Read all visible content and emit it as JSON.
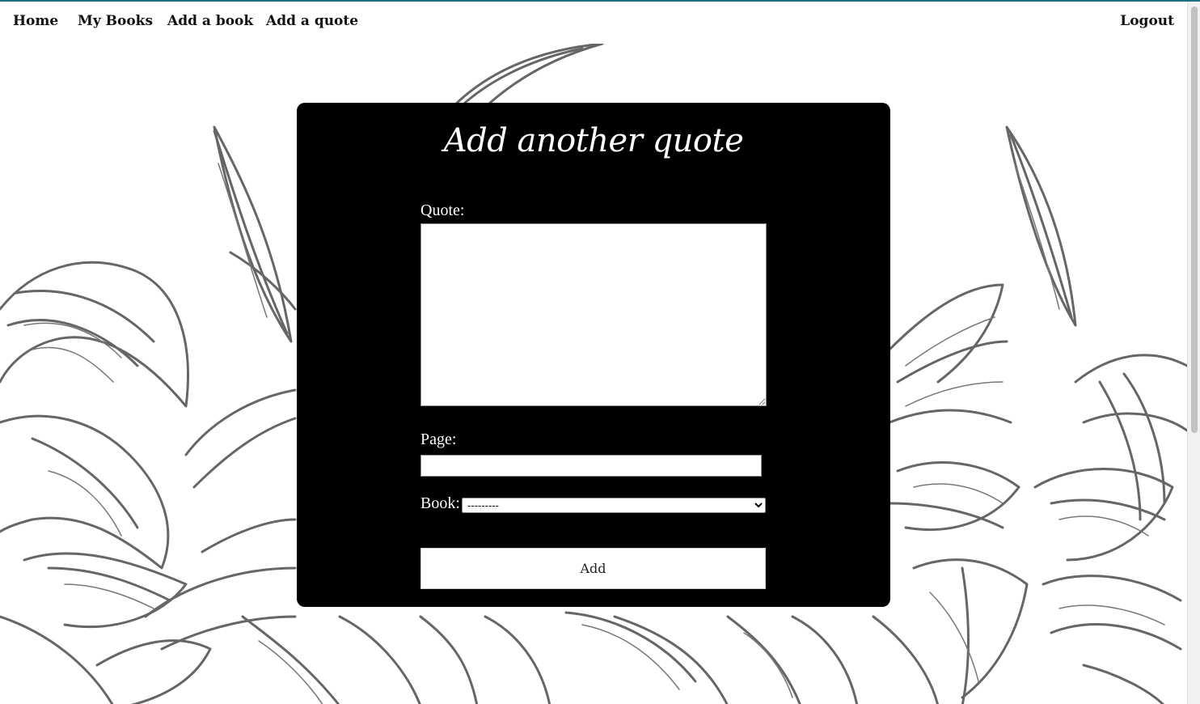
{
  "nav": {
    "home": "Home",
    "my_books": "My Books",
    "add_book": "Add a book",
    "add_quote": "Add a quote",
    "logout": "Logout"
  },
  "form": {
    "title": "Add another quote",
    "quote_label": "Quote:",
    "quote_value": "",
    "page_label": "Page:",
    "page_value": "",
    "book_label": "Book:",
    "book_selected": "---------",
    "submit_label": "Add"
  },
  "icons": {
    "background": "botanical-leaves-illustration"
  },
  "colors": {
    "card_background": "#000000",
    "page_background": "#ffffff",
    "leaf_stroke": "#666666"
  }
}
